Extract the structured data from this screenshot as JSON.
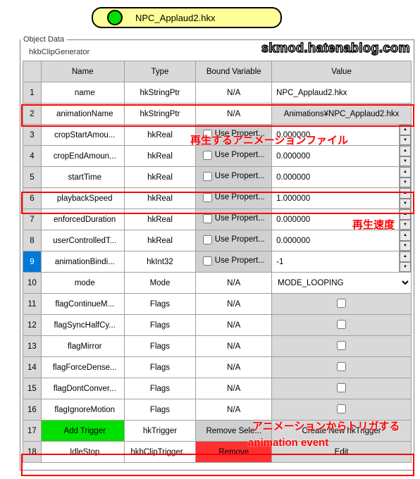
{
  "watermark": "skmod.hatenablog.com",
  "top_node_label": "NPC_Applaud2.hkx",
  "panel": {
    "legend": "Object Data",
    "sub_label": "hkbClipGenerator"
  },
  "headers": {
    "name": "Name",
    "type": "Type",
    "bound": "Bound Variable",
    "value": "Value"
  },
  "labels": {
    "use_property": "Use Propert...",
    "remove_selected": "Remove Sele...",
    "remove": "Remove",
    "add_trigger_btn": "Add Trigger",
    "edit_btn": "Edit",
    "na": "N/A"
  },
  "rows": [
    {
      "idx": "1",
      "name": "name",
      "type": "hkStringPtr",
      "bound": "na",
      "value_kind": "readonly",
      "value": "NPC_Applaud2.hkx"
    },
    {
      "idx": "2",
      "name": "animationName",
      "type": "hkStringPtr",
      "bound": "na",
      "value_kind": "readonly_gray",
      "value": "Animations¥NPC_Applaud2.hkx"
    },
    {
      "idx": "3",
      "name": "cropStartAmou...",
      "type": "hkReal",
      "bound": "useprop",
      "value_kind": "spinner",
      "value": "0.000000"
    },
    {
      "idx": "4",
      "name": "cropEndAmoun...",
      "type": "hkReal",
      "bound": "useprop",
      "value_kind": "spinner",
      "value": "0.000000"
    },
    {
      "idx": "5",
      "name": "startTime",
      "type": "hkReal",
      "bound": "useprop",
      "value_kind": "spinner",
      "value": "0.000000"
    },
    {
      "idx": "6",
      "name": "playbackSpeed",
      "type": "hkReal",
      "bound": "useprop",
      "value_kind": "spinner",
      "value": "1.000000"
    },
    {
      "idx": "7",
      "name": "enforcedDuration",
      "type": "hkReal",
      "bound": "useprop",
      "value_kind": "spinner",
      "value": "0.000000"
    },
    {
      "idx": "8",
      "name": "userControlledT...",
      "type": "hkReal",
      "bound": "useprop",
      "value_kind": "spinner",
      "value": "0.000000"
    },
    {
      "idx": "9",
      "name": "animationBindi...",
      "type": "hkInt32",
      "bound": "useprop",
      "value_kind": "spinner",
      "value": "-1",
      "idx_selected": true
    },
    {
      "idx": "10",
      "name": "mode",
      "type": "Mode",
      "bound": "na",
      "value_kind": "select",
      "value": "MODE_LOOPING"
    },
    {
      "idx": "11",
      "name": "flagContinueM...",
      "type": "Flags",
      "bound": "na",
      "value_kind": "check"
    },
    {
      "idx": "12",
      "name": "flagSyncHalfCy...",
      "type": "Flags",
      "bound": "na",
      "value_kind": "check"
    },
    {
      "idx": "13",
      "name": "flagMirror",
      "type": "Flags",
      "bound": "na",
      "value_kind": "check"
    },
    {
      "idx": "14",
      "name": "flagForceDense...",
      "type": "Flags",
      "bound": "na",
      "value_kind": "check"
    },
    {
      "idx": "15",
      "name": "flagDontConver...",
      "type": "Flags",
      "bound": "na",
      "value_kind": "check"
    },
    {
      "idx": "16",
      "name": "flagIgnoreMotion",
      "type": "Flags",
      "bound": "na",
      "value_kind": "check"
    },
    {
      "idx": "17",
      "name_kind": "add_trigger",
      "type": "hkTrigger",
      "bound_kind": "remove_selected",
      "value_kind": "readonly_gray",
      "value": "Create New hkTrigger"
    },
    {
      "idx": "18",
      "name": "IdleStop",
      "type": "hkbClipTrigger...",
      "bound_kind": "remove",
      "value_kind": "edit_button"
    }
  ],
  "annotations": {
    "anim_file": "再生するアニメーションファイル",
    "speed": "再生速度",
    "trigger1": "アニメーションからトリガする",
    "trigger2": "animation event"
  }
}
